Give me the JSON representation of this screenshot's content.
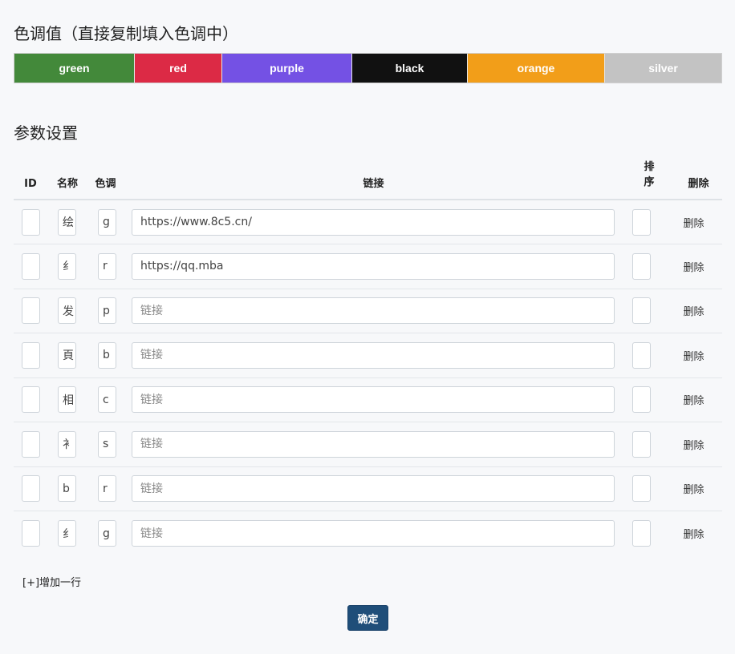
{
  "colors_section": {
    "title": "色调值（直接复制填入色调中）",
    "swatches": [
      {
        "label": "green",
        "color": "#43893a"
      },
      {
        "label": "red",
        "color": "#dc2a45"
      },
      {
        "label": "purple",
        "color": "#7451e4"
      },
      {
        "label": "black",
        "color": "#111111"
      },
      {
        "label": "orange",
        "color": "#f29e19"
      },
      {
        "label": "silver",
        "color": "#c3c3c3"
      }
    ]
  },
  "params_section": {
    "title": "参数设置",
    "headers": {
      "id": "ID",
      "name": "名称",
      "color": "色调",
      "link": "链接",
      "sort_line1": "排",
      "sort_line2": "序",
      "delete": "删除"
    },
    "link_placeholder": "链接",
    "rows": [
      {
        "id": "",
        "name": "绘",
        "color": "g",
        "link": "https://www.8c5.cn/",
        "sort": "",
        "delete": "删除"
      },
      {
        "id": "",
        "name": "纟",
        "color": "r",
        "link": "https://qq.mba",
        "sort": "",
        "delete": "删除"
      },
      {
        "id": "",
        "name": "发",
        "color": "p",
        "link": "",
        "sort": "",
        "delete": "删除"
      },
      {
        "id": "",
        "name": "頁",
        "color": "b",
        "link": "",
        "sort": "",
        "delete": "删除"
      },
      {
        "id": "",
        "name": "相",
        "color": "c",
        "link": "",
        "sort": "",
        "delete": "删除"
      },
      {
        "id": "",
        "name": "衤",
        "color": "s",
        "link": "",
        "sort": "",
        "delete": "删除"
      },
      {
        "id": "",
        "name": "b",
        "color": "r",
        "link": "",
        "sort": "",
        "delete": "删除"
      },
      {
        "id": "",
        "name": "纟",
        "color": "g",
        "link": "",
        "sort": "",
        "delete": "删除"
      }
    ],
    "add_row_label": "[+]增加一行",
    "confirm_label": "确定"
  }
}
